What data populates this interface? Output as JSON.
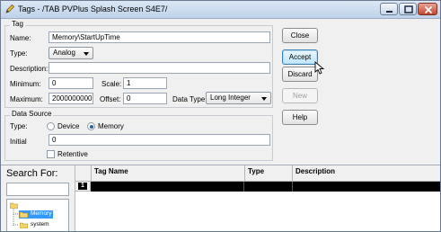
{
  "window": {
    "title": "Tags - /TAB PVPlus Splash Screen S4E7/"
  },
  "tag_group": {
    "label": "Tag",
    "name_label": "Name:",
    "name_value": "Memory\\StartUpTime",
    "type_label": "Type:",
    "type_value": "Analog",
    "description_label": "Description:",
    "description_value": "",
    "minimum_label": "Minimum:",
    "minimum_value": "0",
    "scale_label": "Scale:",
    "scale_value": "1",
    "maximum_label": "Maximum:",
    "maximum_value": "2000000000",
    "offset_label": "Offset:",
    "offset_value": "0",
    "data_type_label": "Data Type:",
    "data_type_value": "Long Integer"
  },
  "data_source": {
    "label": "Data Source",
    "type_label": "Type:",
    "device_label": "Device",
    "memory_label": "Memory",
    "selected": "Memory",
    "initial_label": "Initial",
    "initial_value": "0",
    "retentive_label": "Retentive",
    "retentive_checked": false
  },
  "buttons": {
    "close": "Close",
    "accept": "Accept",
    "discard": "Discard",
    "new": "New",
    "help": "Help"
  },
  "search": {
    "title": "Search For:",
    "value": ""
  },
  "tree": {
    "items": [
      {
        "label": "Memory",
        "selected": true
      },
      {
        "label": "system",
        "selected": false
      }
    ]
  },
  "grid": {
    "columns": [
      "Tag Name",
      "Type",
      "Description"
    ],
    "rows": [
      {
        "number": "1",
        "tag_name": "",
        "type": "",
        "description": ""
      }
    ]
  }
}
